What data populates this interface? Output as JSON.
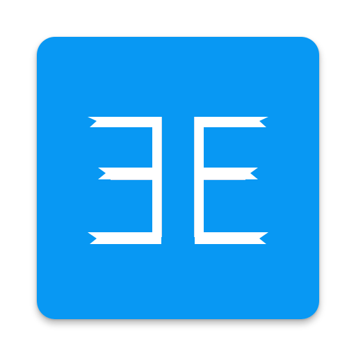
{
  "icon": {
    "name": "mirrored-e-logo-icon",
    "background_color": "#0898F3",
    "glyph_color": "#FFFFFF",
    "glyph_shade_color": "#D2DEEE"
  }
}
